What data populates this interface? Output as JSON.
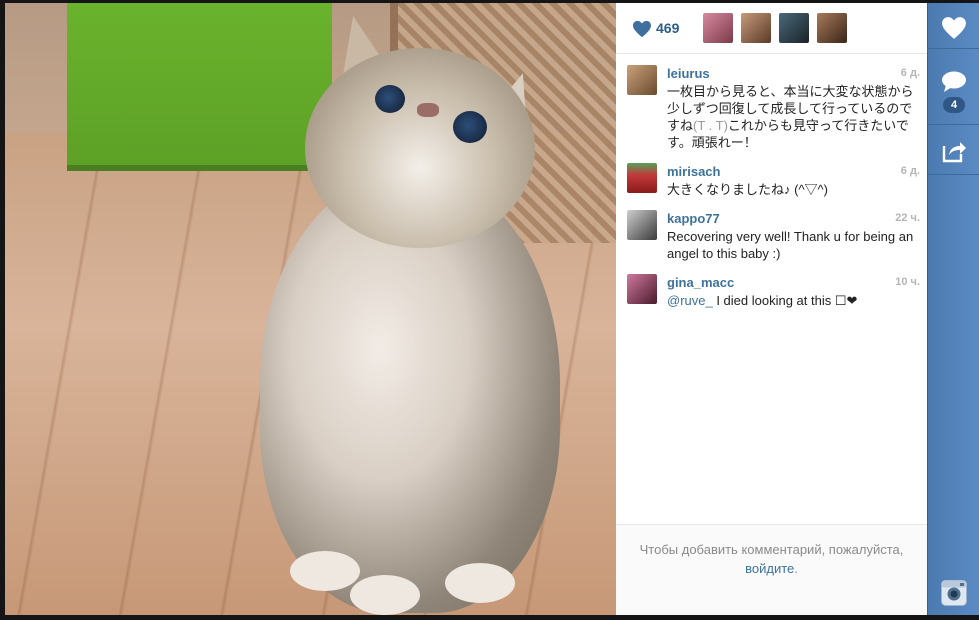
{
  "likes": {
    "count": "469",
    "icon": "heart-icon"
  },
  "likers": [
    {
      "name": "liker-1",
      "color": "#b05a6a"
    },
    {
      "name": "liker-2",
      "color": "#8a5a44"
    },
    {
      "name": "liker-3",
      "color": "#2a3a44"
    },
    {
      "name": "liker-4",
      "color": "#6b4a35"
    }
  ],
  "comments": [
    {
      "user": "leiurus",
      "time": "6 д.",
      "text_parts": [
        "一枚目から見ると、本当に大変な状態から少しずつ回復して成長して行っているのですね",
        "(T . T)",
        "これからも見守って行きたいです。頑張れー！"
      ],
      "avatar_color": "#8c6a4a"
    },
    {
      "user": "mirisach",
      "time": "6 д.",
      "text": "大きくなりましたね♪ (^▽^)",
      "avatar_color": "#c23a3a"
    },
    {
      "user": "kappo77",
      "time": "22 ч.",
      "text": "Recovering very well! Thank u for being an angel to this baby :)",
      "avatar_color": "#555555"
    },
    {
      "user": "gina_macc",
      "time": "10 ч.",
      "mention": "@ruve_",
      "text": " I died looking at this ☐❤",
      "avatar_color": "#7a3a5a"
    }
  ],
  "footer": {
    "prompt": "Чтобы добавить комментарий, пожалуйста,",
    "login": "войдите",
    "period": "."
  },
  "actions": {
    "comment_count": "4"
  },
  "colors": {
    "accent": "#3f729b",
    "sidebar": "#5282b9"
  }
}
